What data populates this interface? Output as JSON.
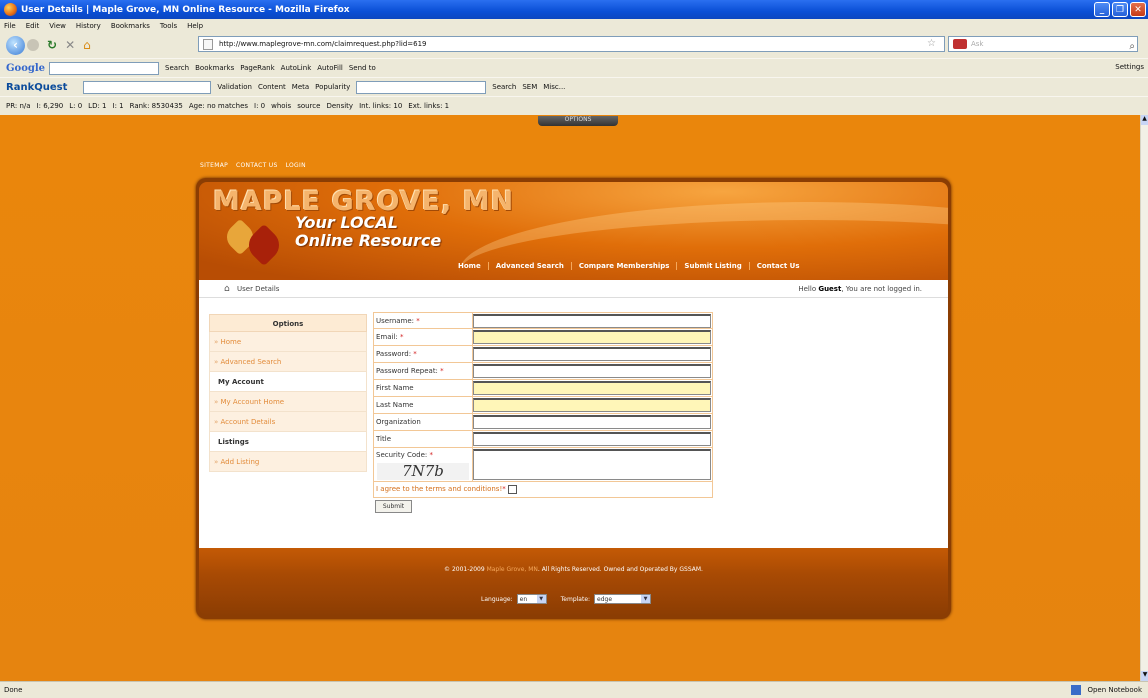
{
  "window": {
    "title": "User Details | Maple Grove, MN Online Resource - Mozilla Firefox",
    "minimize": "_",
    "restore": "❐",
    "close": "✕"
  },
  "menu": [
    "File",
    "Edit",
    "View",
    "History",
    "Bookmarks",
    "Tools",
    "Help"
  ],
  "address": {
    "url": "http://www.maplegrove-mn.com/claimrequest.php?lid=619",
    "search_placeholder": "Ask"
  },
  "google_toolbar": {
    "logo": "Google",
    "items": [
      "Search",
      "Bookmarks",
      "PageRank",
      "AutoLink",
      "AutoFill",
      "Send to"
    ],
    "settings": "Settings"
  },
  "rankquest_toolbar": {
    "logo": "RankQuest",
    "items": [
      "Validation",
      "Content",
      "Meta",
      "Popularity"
    ],
    "right": [
      "Search",
      "SEM",
      "Misc..."
    ]
  },
  "seo_toolbar": {
    "items": [
      "PR: n/a",
      "I: 6,290",
      "L: 0",
      "LD: 1",
      "I: 1",
      "Rank: 8530435",
      "Age: no matches",
      "I: 0",
      "whois",
      "source",
      "Density",
      "Int. links: 10",
      "Ext. links: 1"
    ],
    "options_tab": "OPTIONS"
  },
  "site": {
    "top_links": [
      "SITEMAP",
      "CONTACT US",
      "LOGIN"
    ],
    "brand": "MAPLE GROVE, MN",
    "tagline_line1": "Your LOCAL",
    "tagline_line2": "Online Resource",
    "nav": [
      "Home",
      "Advanced Search",
      "Compare Memberships",
      "Submit Listing",
      "Contact Us"
    ]
  },
  "breadcrumb": {
    "current": "User Details",
    "hello_prefix": "Hello ",
    "hello_user": "Guest",
    "hello_suffix": ", You are not logged in."
  },
  "sidebar": {
    "header": "Options",
    "home": "Home",
    "advanced_search": "Advanced Search",
    "my_account": "My Account",
    "my_account_home": "My Account Home",
    "account_details": "Account Details",
    "listings": "Listings",
    "add_listing": "Add Listing"
  },
  "form": {
    "username": "Username:",
    "email": "Email:",
    "password": "Password:",
    "password_repeat": "Password Repeat:",
    "first_name": "First Name",
    "last_name": "Last Name",
    "organization": "Organization",
    "title": "Title",
    "security_code": "Security Code:",
    "captcha": "7N7b",
    "required_mark": "*",
    "terms": "I agree to the terms and conditions!",
    "submit": "Submit"
  },
  "footer": {
    "copyright_prefix": "© 2001-2009 ",
    "copyright_brand": "Maple Grove, MN",
    "copyright_suffix": ". All Rights Reserved. Owned and Operated By GSSAM.",
    "language_label": "Language:",
    "language_value": "en",
    "template_label": "Template:",
    "template_value": "edge"
  },
  "status": {
    "left": "Done",
    "notebook": "Open Notebook"
  },
  "colors": {
    "page_orange": "#e9810b",
    "header_brown": "#8b3d03",
    "link_orange": "#e28c3b"
  }
}
